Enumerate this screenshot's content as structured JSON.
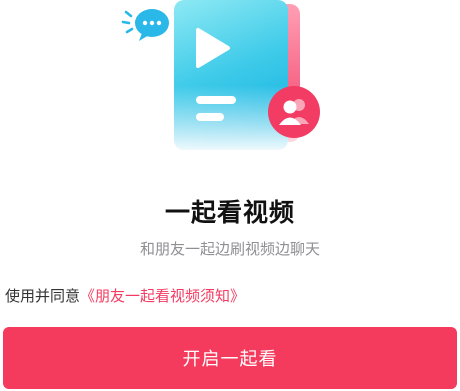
{
  "hero": {
    "illustration_icon": "video-card-with-friends-icon",
    "chat_icon": "chat-bubble-icon",
    "play_icon": "play-icon",
    "friends_icon": "users-badge-icon"
  },
  "title": "一起看视频",
  "subtitle": "和朋友一起边刷视频边聊天",
  "agreement": {
    "prefix": "使用并同意",
    "link_label": "《朋友一起看视频须知》"
  },
  "start_button_label": "开启一起看",
  "colors": {
    "accent": "#f43b5e",
    "card_gradient_top": "#7ee6f2",
    "card_gradient_bottom": "#2fc4e6",
    "chat_bubble": "#29b8e8",
    "muted_text": "#8f8f94"
  }
}
